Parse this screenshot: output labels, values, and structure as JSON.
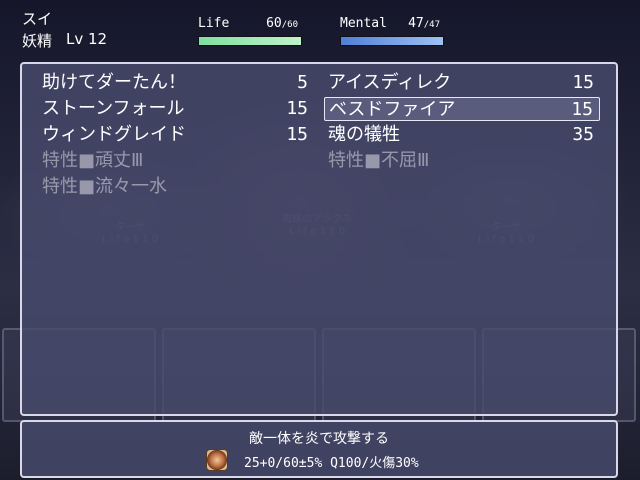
{
  "actor": {
    "name": "スイ",
    "class": "妖精",
    "level_label": "Lv 12"
  },
  "gauges": {
    "life": {
      "label": "Life",
      "current": "60",
      "max": "/60",
      "ratio": 1.0,
      "color": "#9fe8b4"
    },
    "mental": {
      "label": "Mental",
      "current": "47",
      "max": "/47",
      "ratio": 1.0,
      "color": "#7ea6ec"
    }
  },
  "skills": [
    {
      "name": "助けてダーたん！",
      "cost": "5",
      "enabled": true,
      "selected": false
    },
    {
      "name": "アイスディレク",
      "cost": "15",
      "enabled": true,
      "selected": false
    },
    {
      "name": "ストーンフォール",
      "cost": "15",
      "enabled": true,
      "selected": false
    },
    {
      "name": "ベスドファイア",
      "cost": "15",
      "enabled": true,
      "selected": true
    },
    {
      "name": "ウィンドグレイド",
      "cost": "15",
      "enabled": true,
      "selected": false
    },
    {
      "name": "魂の犠牲",
      "cost": "35",
      "enabled": true,
      "selected": false
    },
    {
      "name": "特性■頑丈Ⅲ",
      "cost": "",
      "enabled": false,
      "selected": false
    },
    {
      "name": "特性■不屈Ⅲ",
      "cost": "",
      "enabled": false,
      "selected": false
    },
    {
      "name": "特性■流々一水",
      "cost": "",
      "enabled": false,
      "selected": false
    }
  ],
  "help": {
    "description": "敵一体を炎で攻撃する",
    "stats": "25+0/60±5% Q100/火傷30%",
    "icon": "fire-spell-icon"
  }
}
